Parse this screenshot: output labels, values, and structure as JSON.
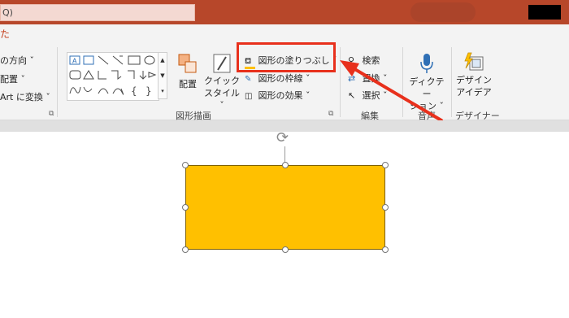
{
  "titlebar": {
    "search_text": "Q)"
  },
  "tabs": {
    "partial_glyph": "た"
  },
  "ribbon": {
    "paragraph": {
      "text_direction": "の方向 ˇ",
      "align_text": "配置 ˇ",
      "smartart": "Art に変換 ˇ"
    },
    "drawing": {
      "arrange_label": "配置",
      "quick_styles_label_line1": "クイック",
      "quick_styles_label_line2": "スタイル ˇ",
      "shape_fill": "図形の塗りつぶし ˇ",
      "shape_outline": "図形の枠線 ˇ",
      "shape_effects": "図形の効果 ˇ",
      "group_label": "図形描画"
    },
    "editing": {
      "find": "検索",
      "replace": "置換 ˇ",
      "select": "選択 ˇ",
      "group_label": "編集"
    },
    "voice": {
      "dictate_line1": "ディクテー",
      "dictate_line2": "ション ˇ",
      "group_label": "音声"
    },
    "designer": {
      "ideas_line1": "デザイン",
      "ideas_line2": "アイデア",
      "group_label": "デザイナー"
    }
  },
  "colors": {
    "titlebar": "#b7472a",
    "shape_fill": "#ffc000",
    "highlight": "#e8301c",
    "ribbon_bg": "#f3f3f3"
  },
  "rotate_icon": "⟳"
}
